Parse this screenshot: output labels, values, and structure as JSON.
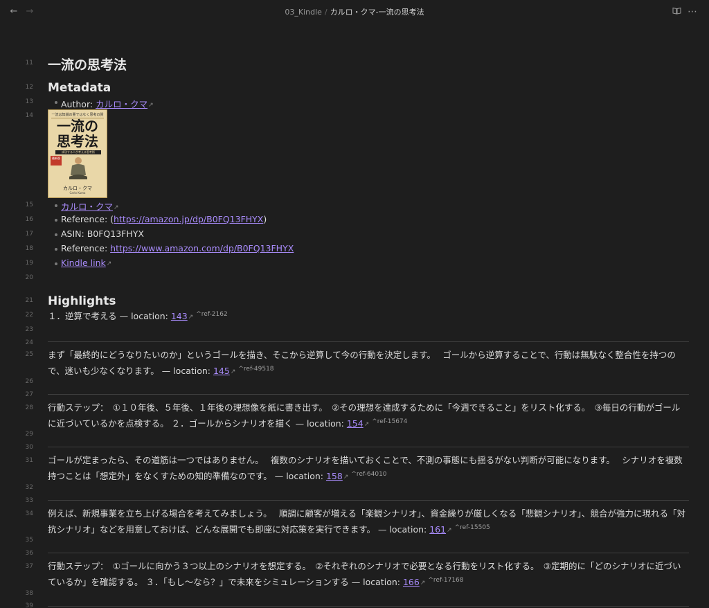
{
  "topbar": {
    "back_icon": "arrow-left-icon",
    "forward_icon": "arrow-right-icon",
    "folder": "03_Kindle",
    "separator": "/",
    "file": "カルロ・クマ-一流の思考法",
    "reading_view_icon": "book-open-icon",
    "more_icon": "more-options-icon"
  },
  "line_numbers": {
    "l11": "11",
    "l12": "12",
    "l13": "13",
    "l14": "14",
    "l15": "15",
    "l16": "16",
    "l17": "17",
    "l18": "18",
    "l19": "19",
    "l20": "20",
    "l21": "21",
    "l22": "22",
    "l23": "23",
    "l24": "24",
    "l25": "25",
    "l26": "26",
    "l27": "27",
    "l28": "28",
    "l29": "29",
    "l30": "30",
    "l31": "31",
    "l32": "32",
    "l33": "33",
    "l34": "34",
    "l35": "35",
    "l36": "36",
    "l37": "37",
    "l38": "38",
    "l39": "39"
  },
  "doc": {
    "title": "一流の思考法",
    "metadata_heading": "Metadata",
    "author_label": "Author: ",
    "author_link": "カルロ・クマ",
    "cover": {
      "top_text": "一流は知識の量ではなく思考の質",
      "title_line1": "一流の",
      "title_line2": "思考法",
      "band_text": "成功する人が考える思考術",
      "badge": "最新版",
      "author": "カルロ・クマ",
      "author_latin": "Carlo Kuma"
    },
    "author_link2": "カルロ・クマ",
    "ref1_label": "Reference: (",
    "ref1_link": "https://amazon.jp/dp/B0FQ13FHYX",
    "ref1_close": ")",
    "asin": "ASIN: B0FQ13FHYX",
    "ref2_label": "Reference: ",
    "ref2_link": "https://www.amazon.com/dp/B0FQ13FHYX",
    "kindle_link": "Kindle link",
    "highlights_heading": "Highlights",
    "h1_text": "１．逆算で考える — location: ",
    "h1_loc": "143",
    "h1_ref": "^ref-2162",
    "p25_text": "まず「最終的にどうなりたいのか」というゴールを描き、そこから逆算して今の行動を決定します。　 ゴールから逆算することで、行動は無駄なく整合性を持つので、迷いも少なくなります。 — location: ",
    "p25_loc": "145",
    "p25_ref": "^ref-49518",
    "p28_text": "行動ステップ：　①１０年後、５年後、１年後の理想像を紙に書き出す。　②その理想を達成するために「今週できること」をリスト化する。　③毎日の行動がゴールに近づいているかを点検する。 ２．ゴールからシナリオを描く — location: ",
    "p28_loc": "154",
    "p28_ref": "^ref-15674",
    "p31_text": "ゴールが定まったら、その道筋は一つではありません。　 複数のシナリオを描いておくことで、不測の事態にも揺るがない判断が可能になります。　 シナリオを複数持つことは「想定外」をなくすための知的準備なのです。 — location: ",
    "p31_loc": "158",
    "p31_ref": "^ref-64010",
    "p34_text": "例えば、新規事業を立ち上げる場合を考えてみましょう。　 順調に顧客が増える「楽観シナリオ」、資金繰りが厳しくなる「悲観シナリオ」、競合が強力に現れる「対抗シナリオ」などを用意しておけば、どんな展開でも即座に対応策を実行できます。 — location: ",
    "p34_loc": "161",
    "p34_ref": "^ref-15505",
    "p37_text": "行動ステップ：　①ゴールに向かう３つ以上のシナリオを想定する。　②それぞれのシナリオで必要となる行動をリスト化する。　③定期的に「どのシナリオに近づいているか」を確認する。 ３．「もし〜なら？」で未来をシミュレーションする — location: ",
    "p37_loc": "166",
    "p37_ref": "^ref-17168",
    "ext_glyph": "↗"
  }
}
